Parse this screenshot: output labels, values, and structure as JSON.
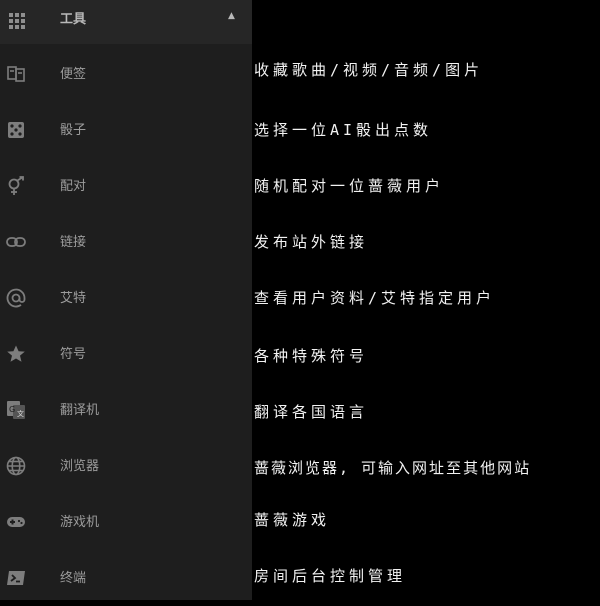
{
  "header": {
    "title": "工具",
    "icon": "grid-icon",
    "caret": "▲"
  },
  "items": [
    {
      "label": "便签",
      "icon": "note-icon",
      "desc": "收藏歌曲/视频/音频/图片"
    },
    {
      "label": "骰子",
      "icon": "dice-icon",
      "desc": "选择一位AI骰出点数"
    },
    {
      "label": "配对",
      "icon": "gender-icon",
      "desc": "随机配对一位蔷薇用户"
    },
    {
      "label": "链接",
      "icon": "link-icon",
      "desc": "发布站外链接"
    },
    {
      "label": "艾特",
      "icon": "at-icon",
      "desc": "查看用户资料/艾特指定用户"
    },
    {
      "label": "符号",
      "icon": "star-icon",
      "desc": "各种特殊符号"
    },
    {
      "label": "翻译机",
      "icon": "translate-icon",
      "desc": "翻译各国语言"
    },
    {
      "label": "浏览器",
      "icon": "globe-icon",
      "desc": "蔷薇浏览器, 可输入网址至其他网站"
    },
    {
      "label": "游戏机",
      "icon": "gamepad-icon",
      "desc": "蔷薇游戏"
    },
    {
      "label": "终端",
      "icon": "terminal-icon",
      "desc": "房间后台控制管理"
    }
  ]
}
